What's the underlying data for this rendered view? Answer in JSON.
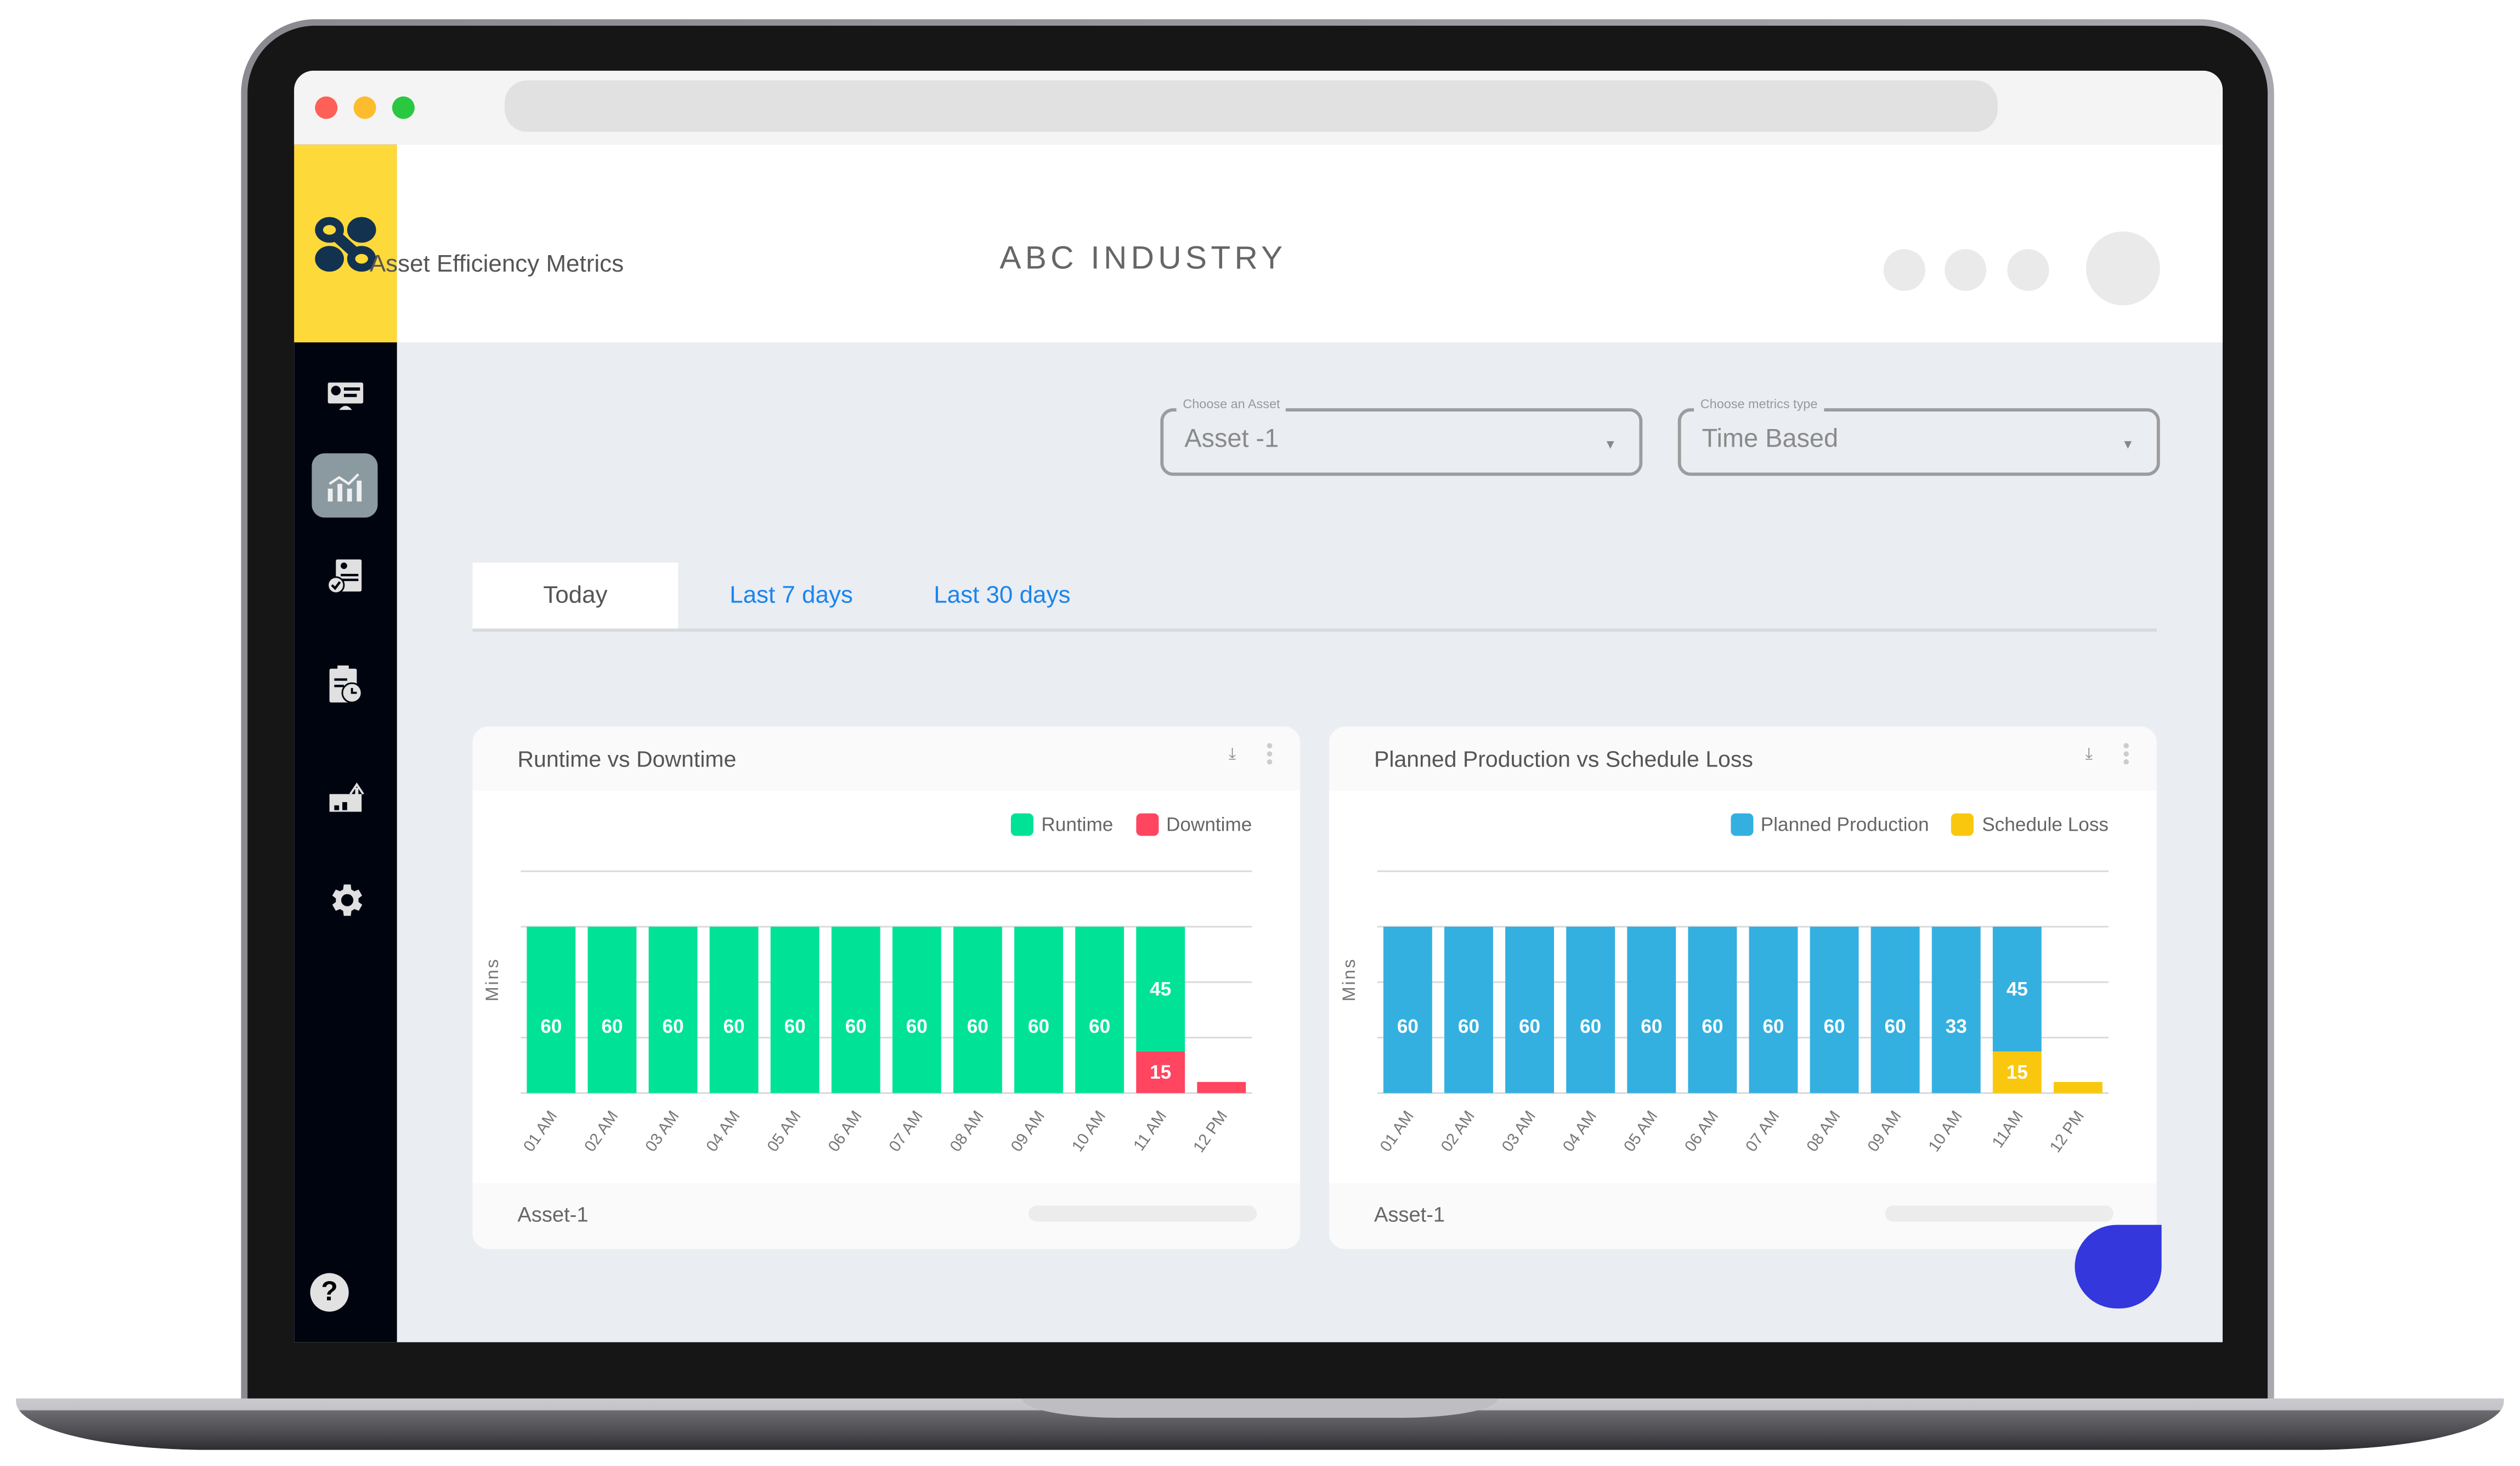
{
  "browser": {
    "traffic_lights": [
      "#fe5f57",
      "#fdbc2e",
      "#29c840"
    ]
  },
  "sidebar": {
    "logo_color": "#fed93a",
    "items": [
      {
        "icon": "dashboard-icon",
        "active": false
      },
      {
        "icon": "analytics-chart-icon",
        "active": true
      },
      {
        "icon": "report-check-icon",
        "active": false
      },
      {
        "icon": "schedule-clipboard-icon",
        "active": false
      },
      {
        "icon": "growth-chart-icon",
        "active": false
      },
      {
        "icon": "gear-icon",
        "active": false
      }
    ],
    "help_icon": "?"
  },
  "header": {
    "page_title": "Asset Efficiency Metrics",
    "company": "ABC INDUSTRY"
  },
  "filters": {
    "asset": {
      "label": "Choose an Asset",
      "value": "Asset -1"
    },
    "metrics_type": {
      "label": "Choose metrics type",
      "value": "Time Based"
    }
  },
  "tabs": [
    {
      "label": "Today",
      "active": true
    },
    {
      "label": "Last 7 days",
      "active": false
    },
    {
      "label": "Last 30 days",
      "active": false
    }
  ],
  "colors": {
    "tab_link": "#1a85ee",
    "runtime": "#00e396",
    "downtime": "#ff4560",
    "planned": "#33b0e0",
    "schedule_loss": "#f9c80e"
  },
  "cards": [
    {
      "title": "Runtime vs Downtime",
      "footer": "Asset-1"
    },
    {
      "title": "Planned Production vs Schedule Loss",
      "footer": "Asset-1"
    }
  ],
  "chart_data": [
    {
      "type": "bar",
      "stacked": true,
      "title": "Runtime vs Downtime",
      "xlabel": "",
      "ylabel": "Mins",
      "ylim": [
        0,
        80
      ],
      "yticks": [
        0,
        20,
        40,
        60,
        80
      ],
      "grid": true,
      "legend_position": "top-right",
      "categories": [
        "01 AM",
        "02 AM",
        "03 AM",
        "04 AM",
        "05 AM",
        "06 AM",
        "07 AM",
        "08 AM",
        "09 AM",
        "10 AM",
        "11 AM",
        "12 PM"
      ],
      "series": [
        {
          "name": "Downtime",
          "color": "#ff4560",
          "values": [
            0,
            0,
            0,
            0,
            0,
            0,
            0,
            0,
            0,
            0,
            15,
            4
          ],
          "labels": [
            "",
            "",
            "",
            "",
            "",
            "",
            "",
            "",
            "",
            "",
            "15",
            ""
          ]
        },
        {
          "name": "Runtime",
          "color": "#00e396",
          "values": [
            60,
            60,
            60,
            60,
            60,
            60,
            60,
            60,
            60,
            60,
            45,
            0
          ],
          "labels": [
            "60",
            "60",
            "60",
            "60",
            "60",
            "60",
            "60",
            "60",
            "60",
            "60",
            "45",
            ""
          ]
        }
      ],
      "legend": [
        "Runtime",
        "Downtime"
      ]
    },
    {
      "type": "bar",
      "stacked": true,
      "title": "Planned Production vs Schedule Loss",
      "xlabel": "",
      "ylabel": "Mins",
      "ylim": [
        0,
        80
      ],
      "yticks": [
        0,
        20,
        40,
        60,
        80
      ],
      "grid": true,
      "legend_position": "top-right",
      "categories": [
        "01 AM",
        "02 AM",
        "03 AM",
        "04 AM",
        "05 AM",
        "06 AM",
        "07 AM",
        "08 AM",
        "09 AM",
        "10 AM",
        "11AM",
        "12 PM"
      ],
      "series": [
        {
          "name": "Schedule Loss",
          "color": "#f9c80e",
          "values": [
            0,
            0,
            0,
            0,
            0,
            0,
            0,
            0,
            0,
            0,
            15,
            4
          ],
          "labels": [
            "",
            "",
            "",
            "",
            "",
            "",
            "",
            "",
            "",
            "",
            "15",
            ""
          ]
        },
        {
          "name": "Planned Production",
          "color": "#33b0e0",
          "values": [
            60,
            60,
            60,
            60,
            60,
            60,
            60,
            60,
            60,
            60,
            45,
            0
          ],
          "labels": [
            "60",
            "60",
            "60",
            "60",
            "60",
            "60",
            "60",
            "60",
            "60",
            "33",
            "45",
            ""
          ]
        }
      ],
      "legend": [
        "Planned Production",
        "Schedule Loss"
      ]
    }
  ]
}
